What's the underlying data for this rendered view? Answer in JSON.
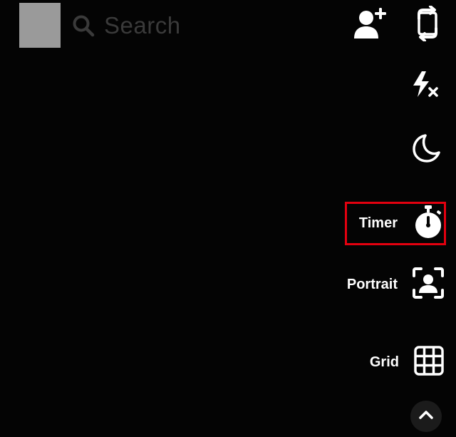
{
  "header": {
    "search_label": "Search"
  },
  "tools": {
    "timer_label": "Timer",
    "portrait_label": "Portrait",
    "grid_label": "Grid"
  },
  "icons": {
    "add_friend": "add-friend-icon",
    "flip_camera": "flip-camera-icon",
    "flash_off": "flash-off-icon",
    "night_mode": "moon-icon",
    "timer": "stopwatch-icon",
    "portrait": "portrait-icon",
    "grid": "grid-icon",
    "collapse": "chevron-up-icon"
  },
  "colors": {
    "background": "#040404",
    "highlight": "#e3000f",
    "avatar_placeholder": "#9a9a9a",
    "search_text": "#3a3a3a",
    "icon": "#ffffff"
  }
}
